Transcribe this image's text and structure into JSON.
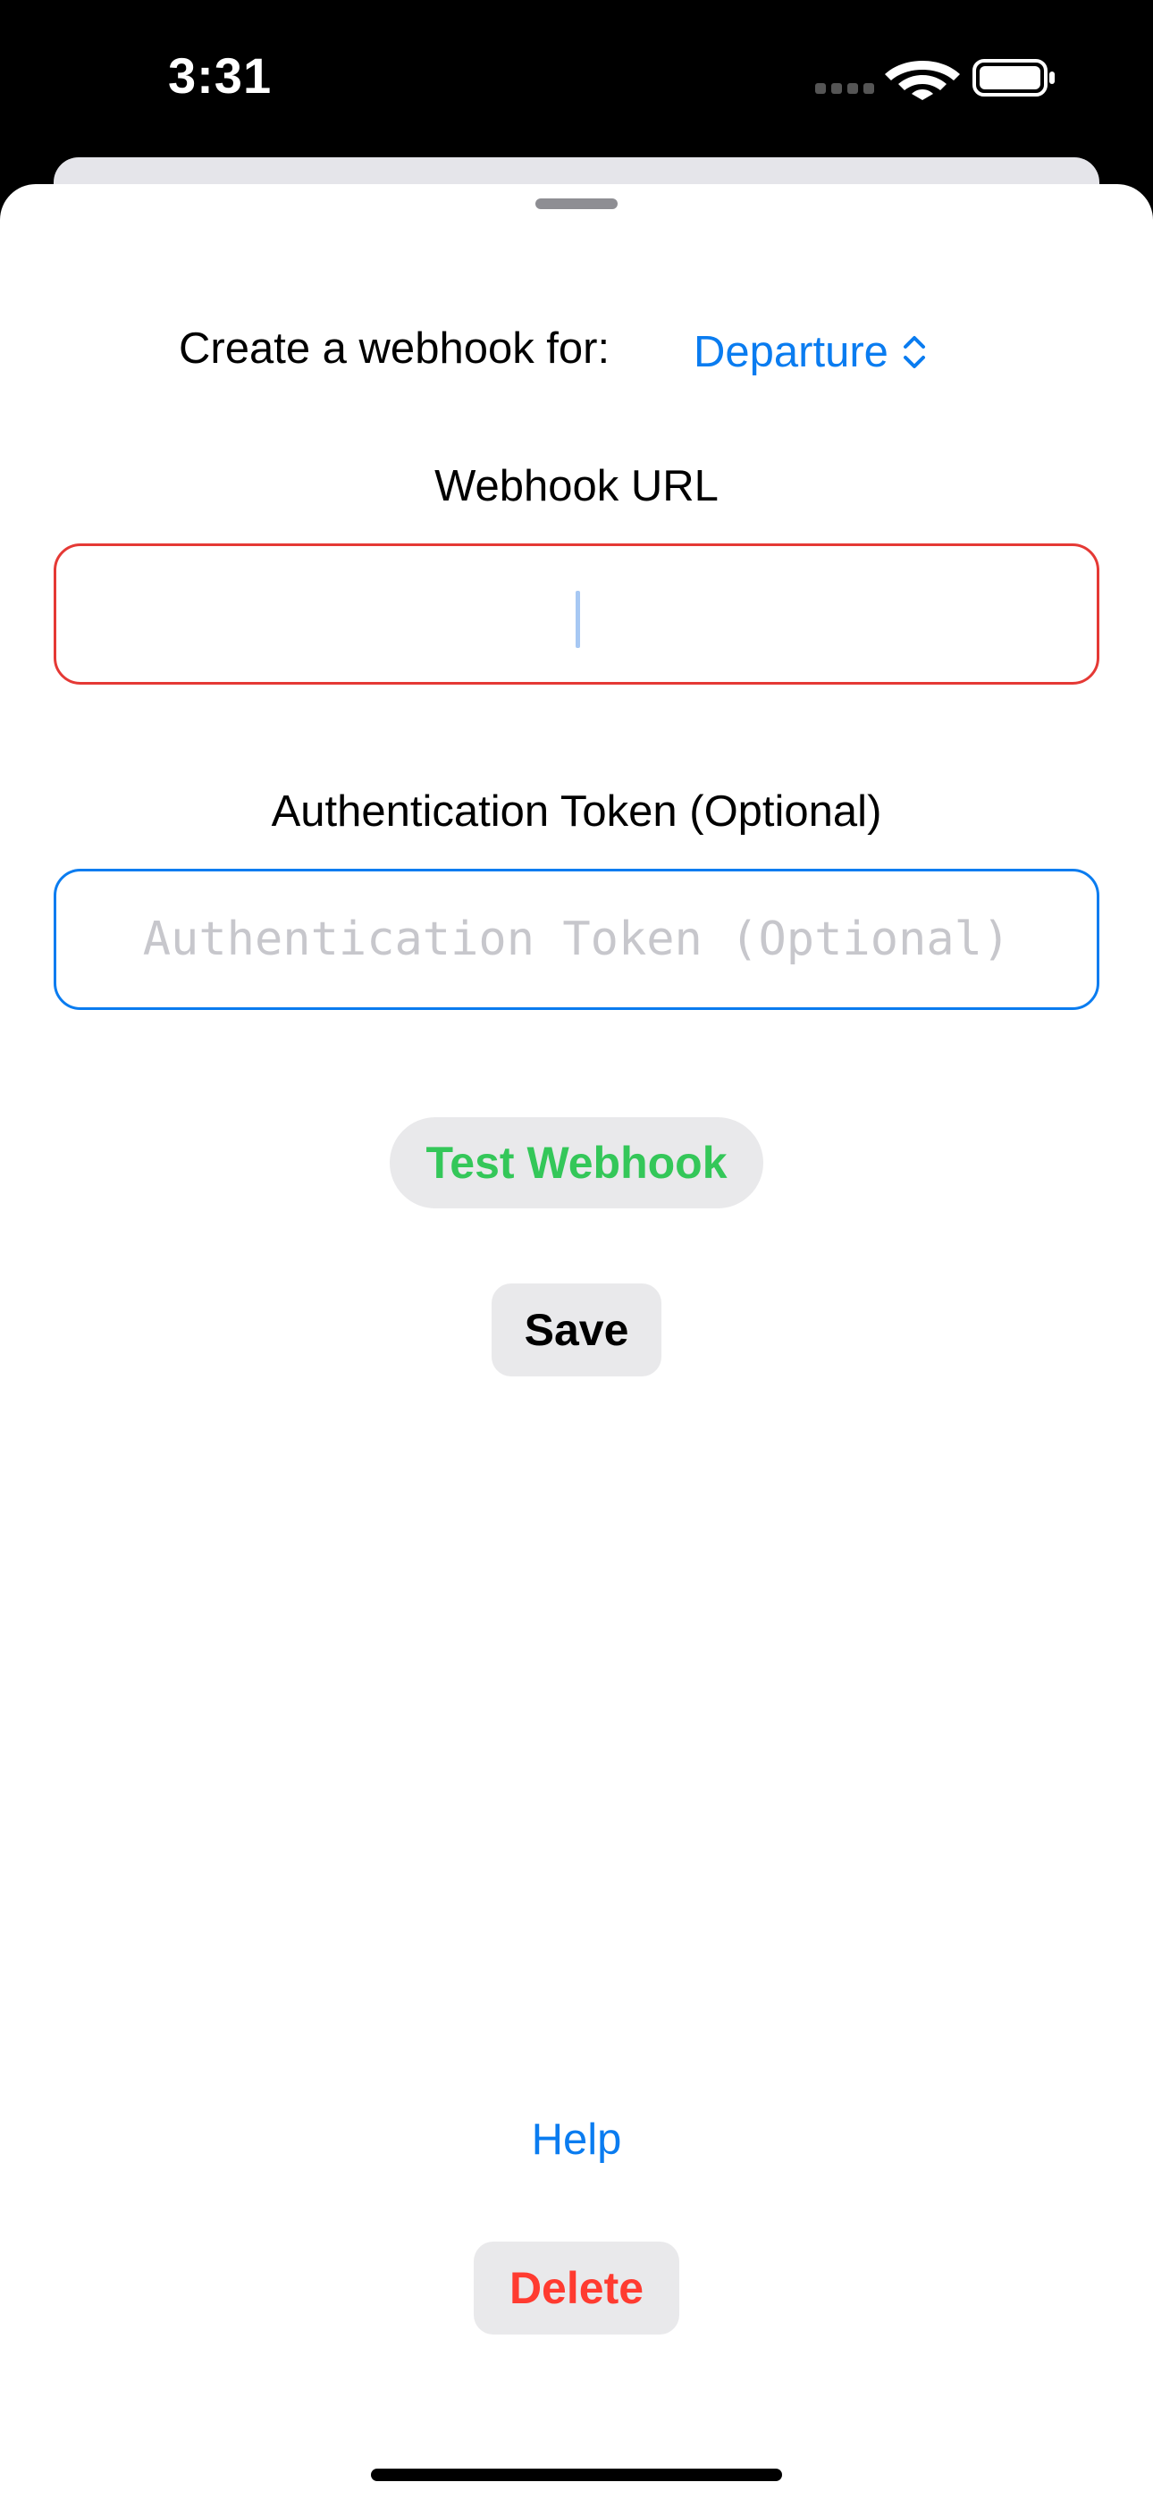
{
  "status_bar": {
    "time": "3:31",
    "icons": [
      "signal-dots-icon",
      "wifi-icon",
      "battery-icon"
    ]
  },
  "form": {
    "webhook_for_label": "Create a webhook for:",
    "event_picker_value": "Departure",
    "webhook_url_label": "Webhook URL",
    "webhook_url_value": "",
    "auth_token_label": "Authentication Token (Optional)",
    "auth_token_placeholder": "Authentication Token (Optional)",
    "auth_token_value": ""
  },
  "actions": {
    "test_label": "Test Webhook",
    "save_label": "Save",
    "help_label": "Help",
    "delete_label": "Delete"
  },
  "colors": {
    "accent": "#0a7cf0",
    "error_border": "#e53935",
    "success": "#34c759",
    "destructive": "#ff3b30",
    "button_bg": "#e9e9eb"
  }
}
